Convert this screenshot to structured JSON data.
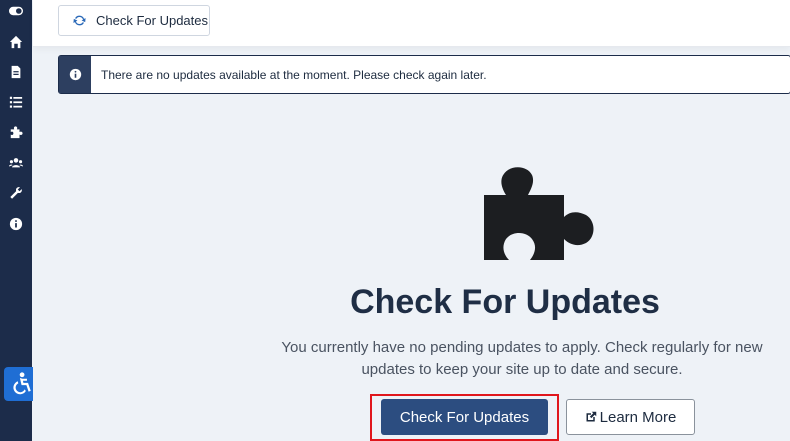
{
  "sidebar": {
    "icons": [
      "toggle-icon",
      "home-icon",
      "document-icon",
      "list-icon",
      "puzzle-icon",
      "users-icon",
      "wrench-icon",
      "info-icon"
    ],
    "accessibility_icon": "accessibility-icon",
    "color": "#1c2c4a"
  },
  "toolbar": {
    "check_updates_label": "Check For Updates",
    "icon": "refresh-icon"
  },
  "alert": {
    "message": "There are no updates available at the moment. Please check again later.",
    "icon": "info-icon"
  },
  "empty_state": {
    "icon": "puzzle-icon",
    "title": "Check For Updates",
    "description": "You currently have no pending updates to apply. Check regularly for new updates to keep your site up to date and secure.",
    "primary_button": "Check For Updates",
    "secondary_button": "Learn More",
    "secondary_icon": "external-link-icon"
  },
  "colors": {
    "primary": "#2c4d80",
    "highlight": "#e0161c",
    "accessibility": "#1f6ed4"
  }
}
